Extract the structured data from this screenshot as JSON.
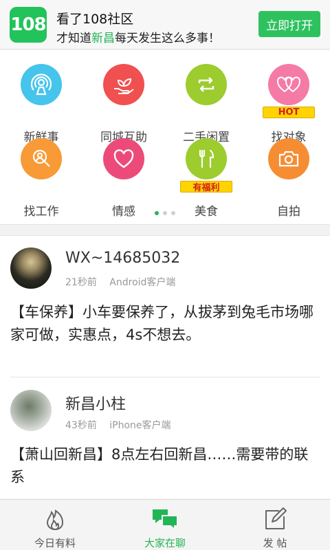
{
  "banner": {
    "logo_text": "108",
    "title": "看了108社区",
    "subtitle_prefix": "才知道",
    "subtitle_highlight": "新昌",
    "subtitle_suffix": "每天发生这么多事！",
    "open_button": "立即打开"
  },
  "categories": [
    {
      "label": "新鲜事",
      "icon": "broadcast-icon",
      "color": "#45c4ec"
    },
    {
      "label": "同城互助",
      "icon": "plant-hand-icon",
      "color": "#f0504f"
    },
    {
      "label": "二手闲置",
      "icon": "exchange-icon",
      "color": "#9ccc2d"
    },
    {
      "label": "找对象",
      "icon": "hearts-icon",
      "color": "#f57aa6",
      "badge": "HOT"
    },
    {
      "label": "找工作",
      "icon": "job-search-icon",
      "color": "#f89a36"
    },
    {
      "label": "情感",
      "icon": "heart-icon",
      "color": "#ec4b7a"
    },
    {
      "label": "美食",
      "icon": "fork-knife-icon",
      "color": "#9ccc2d",
      "badge": "有福利"
    },
    {
      "label": "自拍",
      "icon": "camera-icon",
      "color": "#f68d33"
    }
  ],
  "pager": {
    "count": 3,
    "active": 0
  },
  "posts": [
    {
      "username": "WX~14685032",
      "time": "21秒前",
      "client": "Android客户端",
      "content": "【车保养】小车要保养了，从拔茅到兔毛市场哪家可做，实惠点，4s不想去。"
    },
    {
      "username": "新昌小柱",
      "time": "43秒前",
      "client": "iPhone客户端",
      "content": "【萧山回新昌】8点左右回新昌……需要带的联系"
    }
  ],
  "tabs": [
    {
      "label": "今日有料",
      "icon": "flame-icon",
      "active": false
    },
    {
      "label": "大家在聊",
      "icon": "chat-bubbles-icon",
      "active": true
    },
    {
      "label": "发 帖",
      "icon": "edit-icon",
      "active": false
    }
  ],
  "colors": {
    "accent": "#22b556",
    "button": "#2ec25f",
    "logo": "#22c35a"
  }
}
